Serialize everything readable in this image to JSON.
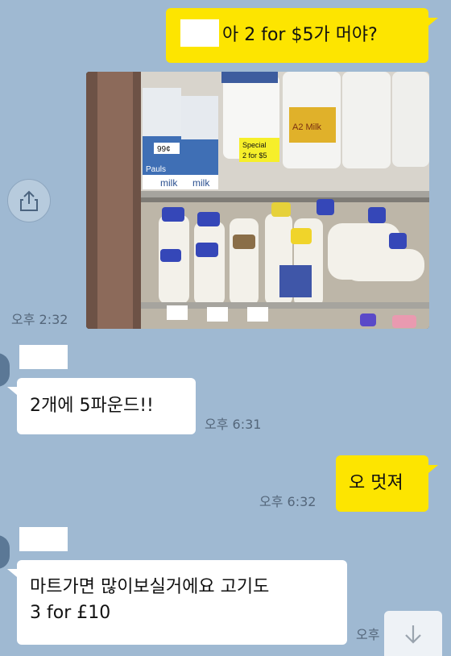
{
  "messages": {
    "m1": {
      "text": "아 2 for $5가 머야?"
    },
    "m2": {
      "time": "오후 2:32"
    },
    "m3": {
      "text": "2개에 5파운드!!",
      "time": "오후 6:31"
    },
    "m4": {
      "text": "오 멋져",
      "time": "오후 6:32"
    },
    "m5": {
      "line1": "마트가면 많이보실거에요 고기도",
      "line2": "3 for £10",
      "time": "오후"
    }
  },
  "photo": {
    "price_tags": [
      "99¢",
      "Special",
      "2 for $5"
    ],
    "labels": [
      "Pauls",
      "milk",
      "milk",
      "A2 Milk"
    ]
  },
  "colors": {
    "background": "#9fb9d2",
    "outgoing_bubble": "#fde500",
    "incoming_bubble": "#ffffff",
    "timestamp": "#54667a"
  },
  "icons": {
    "share": "share-icon",
    "scroll_down": "arrow-down-icon"
  }
}
